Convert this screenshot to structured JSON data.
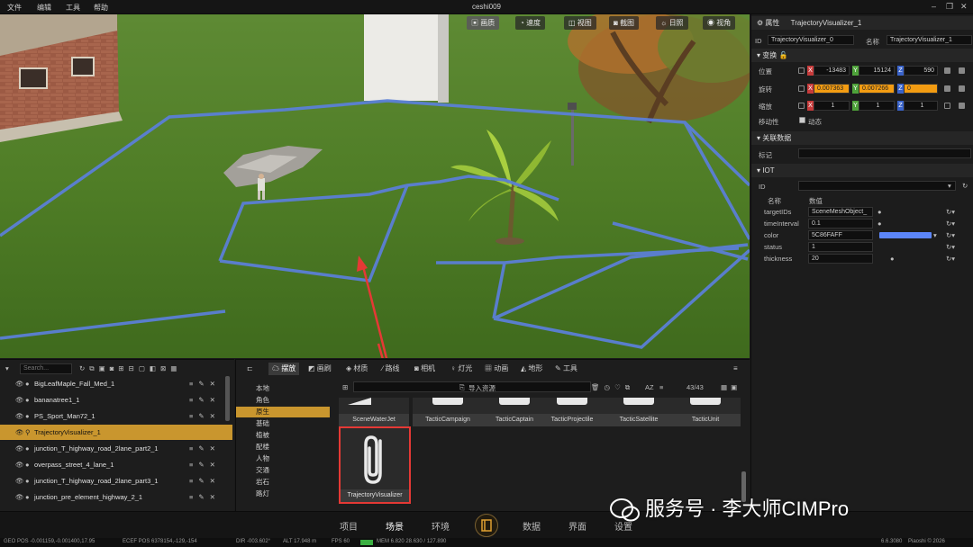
{
  "menu": [
    "文件",
    "编辑",
    "工具",
    "帮助"
  ],
  "app_title": "ceshi009",
  "viewport": {
    "buttons": [
      "画质",
      "速度",
      "视图",
      "截图",
      "日照",
      "视角"
    ]
  },
  "properties": {
    "header": "属性",
    "object_name": "TrajectoryVisualizer_1",
    "id_label": "ID",
    "id_value": "TrajectoryVisualizer_0",
    "name_label": "名称",
    "name_value": "TrajectoryVisualizer_1",
    "transform": {
      "title": "变换",
      "position_label": "位置",
      "position": [
        "-13483",
        "15124",
        "590"
      ],
      "rotation_label": "旋转",
      "rotation": [
        "0.007363",
        "0.007266",
        "0"
      ],
      "scale_label": "缩放",
      "scale": [
        "1",
        "1",
        "1"
      ],
      "mobility_label": "移动性",
      "mobility_value": "动态",
      "axis_labels": [
        "X",
        "Y",
        "Z"
      ]
    },
    "related": {
      "title": "关联数据",
      "tag_label": "标记"
    },
    "iot": {
      "title": "IOT",
      "id_label": "ID",
      "col_name": "名称",
      "col_value": "数值",
      "rows": [
        {
          "name": "targetIDs",
          "value": "SceneMeshObject_"
        },
        {
          "name": "timeInterval",
          "value": "0.1"
        },
        {
          "name": "color",
          "value": "5C86FAFF"
        },
        {
          "name": "status",
          "value": "1"
        },
        {
          "name": "thickness",
          "value": "20"
        }
      ],
      "color_swatch": "#5C86FA"
    }
  },
  "outliner": {
    "search_placeholder": "Search...",
    "items": [
      "BigLeafMaple_Fall_Med_1",
      "bananatree1_1",
      "PS_Sport_Man72_1",
      "TrajectoryVisualizer_1",
      "junction_T_highway_road_2lane_part2_1",
      "overpass_street_4_lane_1",
      "junction_T_highway_road_2lane_part3_1",
      "junction_pre_element_highway_2_1"
    ],
    "selected_index": 3
  },
  "assets": {
    "tabs": [
      "摆放",
      "画刷",
      "材质",
      "路线",
      "相机",
      "灯光",
      "动画",
      "地形",
      "工具"
    ],
    "active_tab": 0,
    "categories": [
      "本地",
      "角色",
      "原生",
      "基础",
      "植被",
      "配楼",
      "人物",
      "交通",
      "岩石",
      "路灯"
    ],
    "active_category": 2,
    "import_label": "导入资源",
    "page_count": "43/43",
    "sort_label": "AZ",
    "items_row1": [
      "SceneWaterJet",
      "TacticCampaign",
      "TacticCaptain",
      "TacticProjectile",
      "TacticSatellite",
      "TacticUnit"
    ],
    "selected_item": "TrajectoryVisualizer"
  },
  "bottom_nav": {
    "items": [
      "项目",
      "场景",
      "环境",
      "数据",
      "界面",
      "设置"
    ],
    "active_index": 1
  },
  "status": {
    "geo_pos": "GEO POS -0.001159,-0.001400,17.95",
    "ecef_pos": "ECEF POS 6378154,-129,-154",
    "dir": "DIR -003.602°",
    "alt": "ALT 17.948 m",
    "fps": "FPS 60",
    "mem": "MEM 6.820 28.630 / 127.890",
    "version": "6.6.3080",
    "copyright": "Piaoshi © 2026"
  },
  "watermark": "服务号 · 李大师CIMPro",
  "colors": {
    "accent": "#c9962e",
    "highlight_box": "#e53935",
    "trajectory_line": "#5b7fd6",
    "rotation_field": "#f39c12"
  }
}
